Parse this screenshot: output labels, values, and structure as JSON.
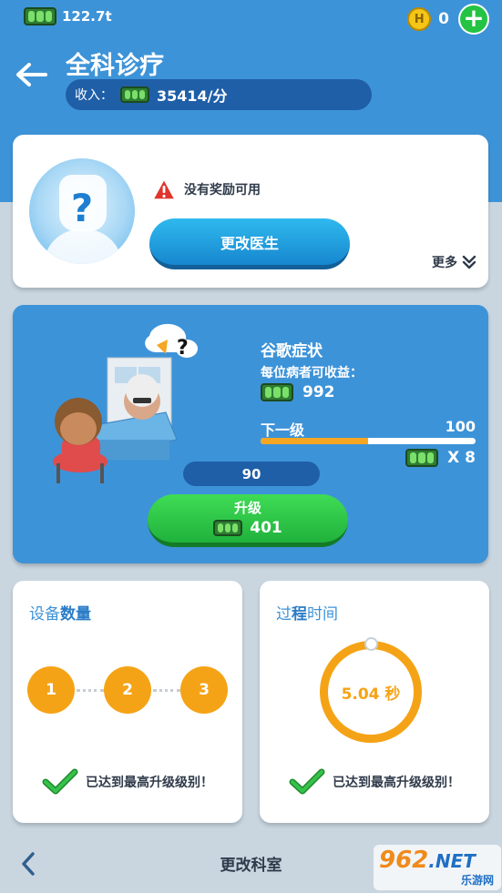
{
  "status": {
    "cash": "122.7t",
    "coins": "0",
    "coin_symbol": "H",
    "add_symbol": "+"
  },
  "header": {
    "title": "全科诊疗",
    "income_label": "收入：",
    "income_value": "35414/分"
  },
  "doctor": {
    "warning": "没有奖励可用",
    "change_doctor": "更改医生",
    "more": "更多",
    "avatar_symbol": "?"
  },
  "upgrade": {
    "disease": "谷歌症状",
    "per_patient_label": "每位病者可收益：",
    "per_patient_value": "992",
    "next_label": "下一级",
    "next_max": "100",
    "next_progress": 0.5,
    "multiplier": "X 8",
    "level": "90",
    "button_label": "升级",
    "button_cost": "401"
  },
  "equipment": {
    "title_part1": "设备",
    "title_part2": "数量",
    "slots": [
      "1",
      "2",
      "3"
    ],
    "maxed_text": "已达到最高升级级别！"
  },
  "process": {
    "title_part1": "过",
    "title_part2": "程",
    "title_part3": "时间",
    "time": "5.04 秒",
    "maxed_text": "已达到最高升级级别！"
  },
  "footer": {
    "title": "更改科室"
  },
  "watermark": {
    "top": "962",
    "top_suffix": ".NET",
    "bottom": "乐游网"
  },
  "colors": {
    "header_blue": "#3d93d8",
    "accent_orange": "#f5a316",
    "button_green": "#20b23c",
    "button_blue": "#1787cf"
  }
}
